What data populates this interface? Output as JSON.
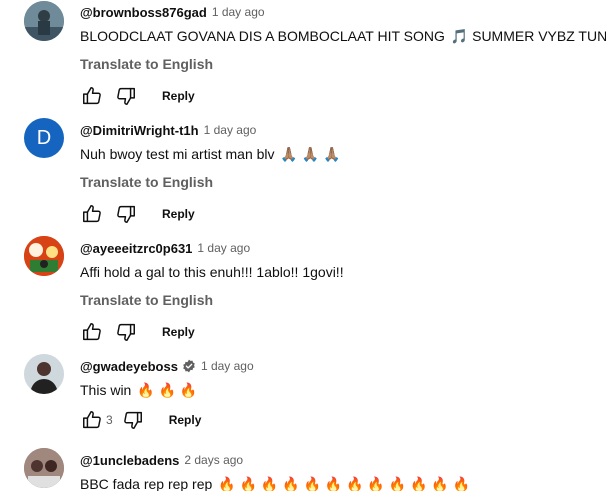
{
  "comments": [
    {
      "handle": "@brownboss876gad",
      "time": "1 day ago",
      "text": "BLOODCLAAT GOVANA DIS A BOMBOCLAAT HIT SONG",
      "text_suffix": "SUMMER VYBZ TUN UP.",
      "emoji": "🎵",
      "translate": "Translate to English",
      "reply": "Reply",
      "likes": ""
    },
    {
      "handle": "@DimitriWright-t1h",
      "time": "1 day ago",
      "avatar_letter": "D",
      "text": "Nuh bwoy test mi artist man blv",
      "emoji": "🙏🏽 🙏🏽 🙏🏽",
      "translate": "Translate to English",
      "reply": "Reply",
      "likes": ""
    },
    {
      "handle": "@ayeeeitzrc0p631",
      "time": "1 day ago",
      "text": "Affi hold a gal to this enuh!!! 1ablo!! 1govi!!",
      "translate": "Translate to English",
      "reply": "Reply",
      "likes": ""
    },
    {
      "handle": "@gwadeyeboss",
      "time": "1 day ago",
      "text": "This win",
      "emoji": "🔥 🔥 🔥",
      "reply": "Reply",
      "likes": "3"
    },
    {
      "handle": "@1unclebadens",
      "time": "2 days ago",
      "text": "BBC fada rep rep rep",
      "emoji": "🔥 🔥 🔥 🔥 🔥 🔥 🔥 🔥 🔥 🔥 🔥 🔥"
    }
  ],
  "colors": {
    "avatar_d": "#1565c0",
    "secondary_text": "#606060",
    "primary_text": "#0f0f0f"
  },
  "icons": [
    "thumbs-up-icon",
    "thumbs-down-icon",
    "verified-badge-icon"
  ]
}
